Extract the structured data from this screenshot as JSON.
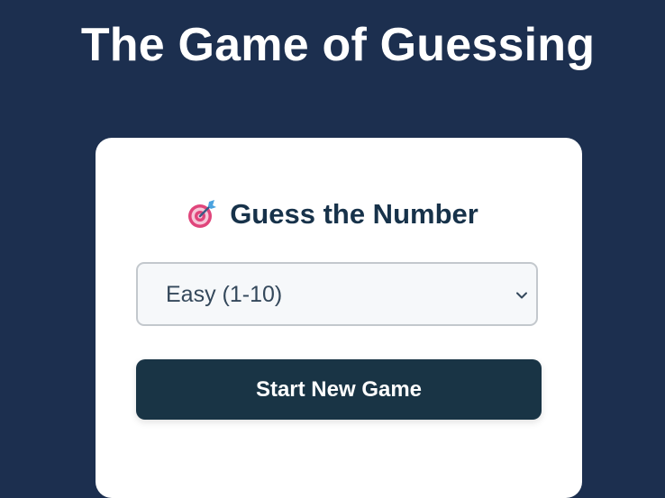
{
  "header": {
    "title": "The Game of Guessing"
  },
  "card": {
    "icon": "target-icon",
    "title": "Guess the Number",
    "difficulty_select": {
      "selected": "Easy (1-10)"
    },
    "start_button_label": "Start New Game"
  },
  "colors": {
    "page_background": "#1c2f4f",
    "card_background": "#ffffff",
    "button_background": "#193445",
    "title_text": "#17324a"
  }
}
